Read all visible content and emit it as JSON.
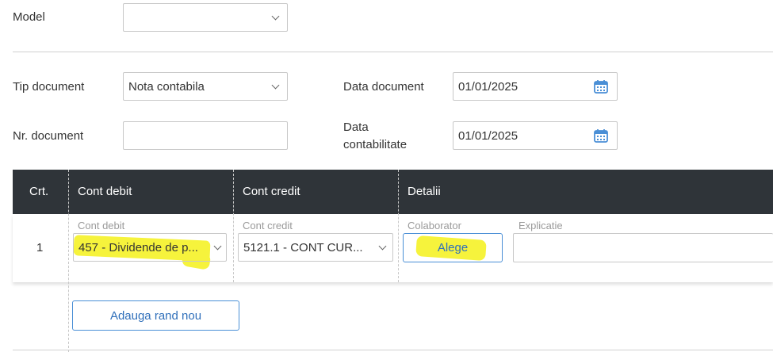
{
  "model": {
    "label": "Model",
    "value": ""
  },
  "document": {
    "tip_label": "Tip document",
    "tip_value": "Nota contabila",
    "nr_label": "Nr. document",
    "nr_value": "",
    "data_doc_label": "Data document",
    "data_doc_value": "01/01/2025",
    "data_cont_label_line1": "Data",
    "data_cont_label_line2": "contabilitate",
    "data_cont_value": "01/01/2025"
  },
  "table": {
    "headers": {
      "crt": "Crt.",
      "debit": "Cont debit",
      "credit": "Cont credit",
      "detalii": "Detalii"
    },
    "rows": [
      {
        "crt": "1",
        "debit_caption": "Cont debit",
        "debit_value": "457 - Dividende de p...",
        "credit_caption": "Cont credit",
        "credit_value": "5121.1 - CONT CUR...",
        "colaborator_caption": "Colaborator",
        "colaborator_button": "Alege",
        "explicatie_caption": "Explicatie",
        "explicatie_value": ""
      }
    ]
  },
  "actions": {
    "add_row": "Adauga rand nou"
  },
  "colors": {
    "header_bg": "#2f3439",
    "highlight": "#f6f33c",
    "accent_blue": "#4a8fd6",
    "calendar_icon": "#4a8fd6"
  }
}
